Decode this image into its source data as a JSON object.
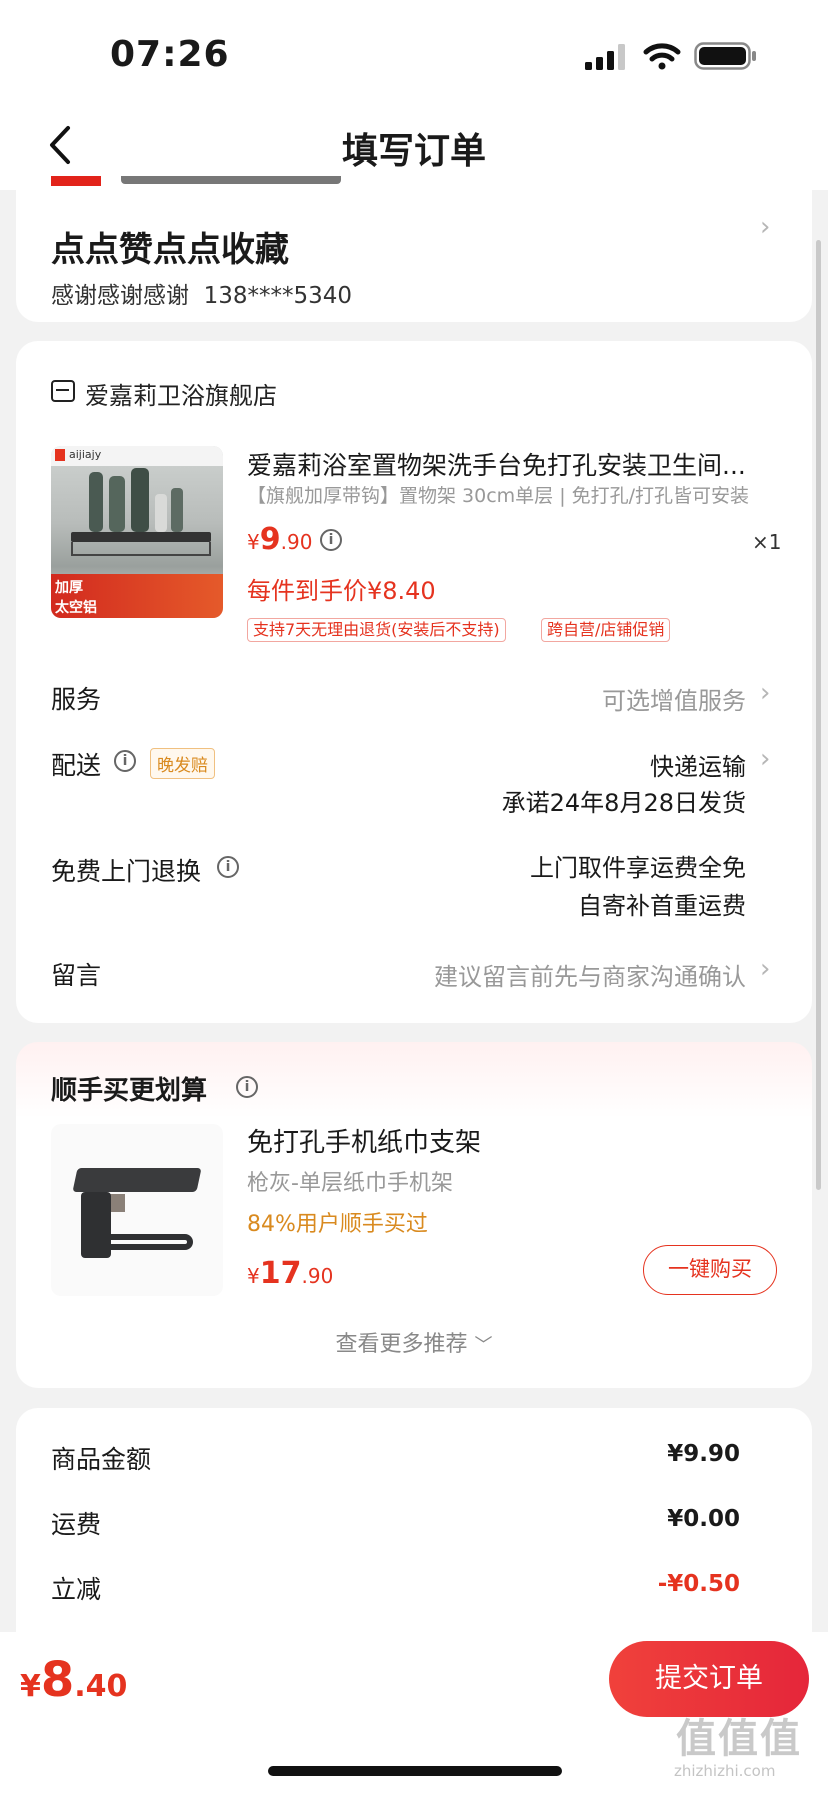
{
  "status_bar": {
    "time": "07:26"
  },
  "nav": {
    "title": "填写订单"
  },
  "address": {
    "name": "点点赞点点收藏",
    "contact": "感谢感谢感谢",
    "phone": "138****5340"
  },
  "store": {
    "name": "爱嘉莉卫浴旗舰店"
  },
  "product": {
    "title": "爱嘉莉浴室置物架洗手台免打孔安装卫生间...",
    "spec": "【旗舰加厚带钩】置物架 30cm单层 | 免打孔/打孔皆可安装",
    "price_cur": "¥",
    "price_int": "9",
    "price_dec": ".90",
    "qty": "×1",
    "hand_price": "每件到手价¥8.40",
    "tags": [
      "支持7天无理由退货(安装后不支持)",
      "跨自营/店铺促销"
    ],
    "image_caption_1": "加厚",
    "image_caption_2": "太空铝",
    "image_brand": "aijiajy"
  },
  "rows": {
    "service_label": "服务",
    "service_value": "可选增值服务",
    "delivery_label": "配送",
    "delivery_badge": "晚发赔",
    "delivery_value": "快递运输",
    "delivery_promise": "承诺24年8月28日发货",
    "free_return_label": "免费上门退换",
    "free_return_line1": "上门取件享运费全免",
    "free_return_line2": "自寄补首重运费",
    "message_label": "留言",
    "message_value": "建议留言前先与商家沟通确认"
  },
  "recommend": {
    "title": "顺手买更划算",
    "name": "免打孔手机纸巾支架",
    "spec": "枪灰-单层纸巾手机架",
    "stat": "84%用户顺手买过",
    "price_cur": "¥",
    "price_int": "17",
    "price_dec": ".90",
    "buy_label": "一键购买",
    "more_label": "查看更多推荐"
  },
  "summary": {
    "items": [
      {
        "label": "商品金额",
        "value": "¥9.90",
        "color": "#1a1a1a"
      },
      {
        "label": "运费",
        "value": "¥0.00",
        "color": "#1a1a1a"
      },
      {
        "label": "立减",
        "value": "-¥0.50",
        "color": "#e5331f"
      }
    ]
  },
  "bottom": {
    "total_cur": "¥",
    "total_int": "8",
    "total_dec": ".40",
    "submit_label": "提交订单"
  },
  "watermark": {
    "text": "值值值",
    "sub": "zhizhizhi.com"
  },
  "colors": {
    "accent": "#e5331f",
    "promo": "#d98a1f"
  }
}
